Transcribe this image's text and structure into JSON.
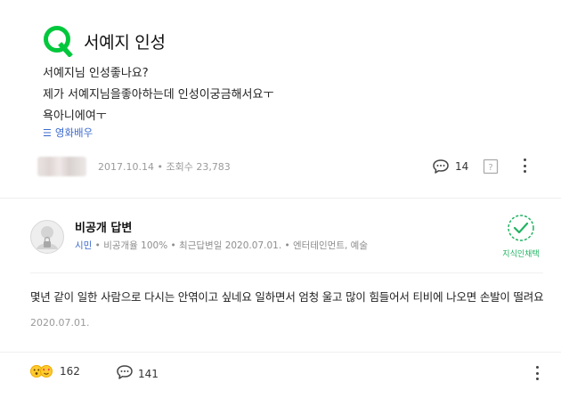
{
  "question": {
    "title": "서예지 인성",
    "body": [
      "서예지님 인성좋나요?",
      "제가 서예지님을좋아하는데 인성이궁금해서요ㅜ",
      "욕아니에여ㅜ"
    ],
    "category_icon": "list-icon",
    "category": "영화배우",
    "meta": "2017.10.14 • 조회수 23,783",
    "comment_count": "14",
    "colors": {
      "brand_green": "#00c73c",
      "link_blue": "#3d6bcf"
    }
  },
  "answer": {
    "name": "비공개 답변",
    "rank": "시민",
    "meta": " • 비공개율 100% • 최근답변일 2020.07.01. • 엔터테인먼트, 예술",
    "chosen_label": "지식인채택",
    "body": "몇년 같이 일한 사람으로 다시는 안엮이고 싶네요 일하면서 엄청 울고 많이 힘들어서 티비에 나오면 손발이 떨려요",
    "date": "2020.07.01.",
    "reaction_count": "162",
    "comment_count": "141"
  }
}
